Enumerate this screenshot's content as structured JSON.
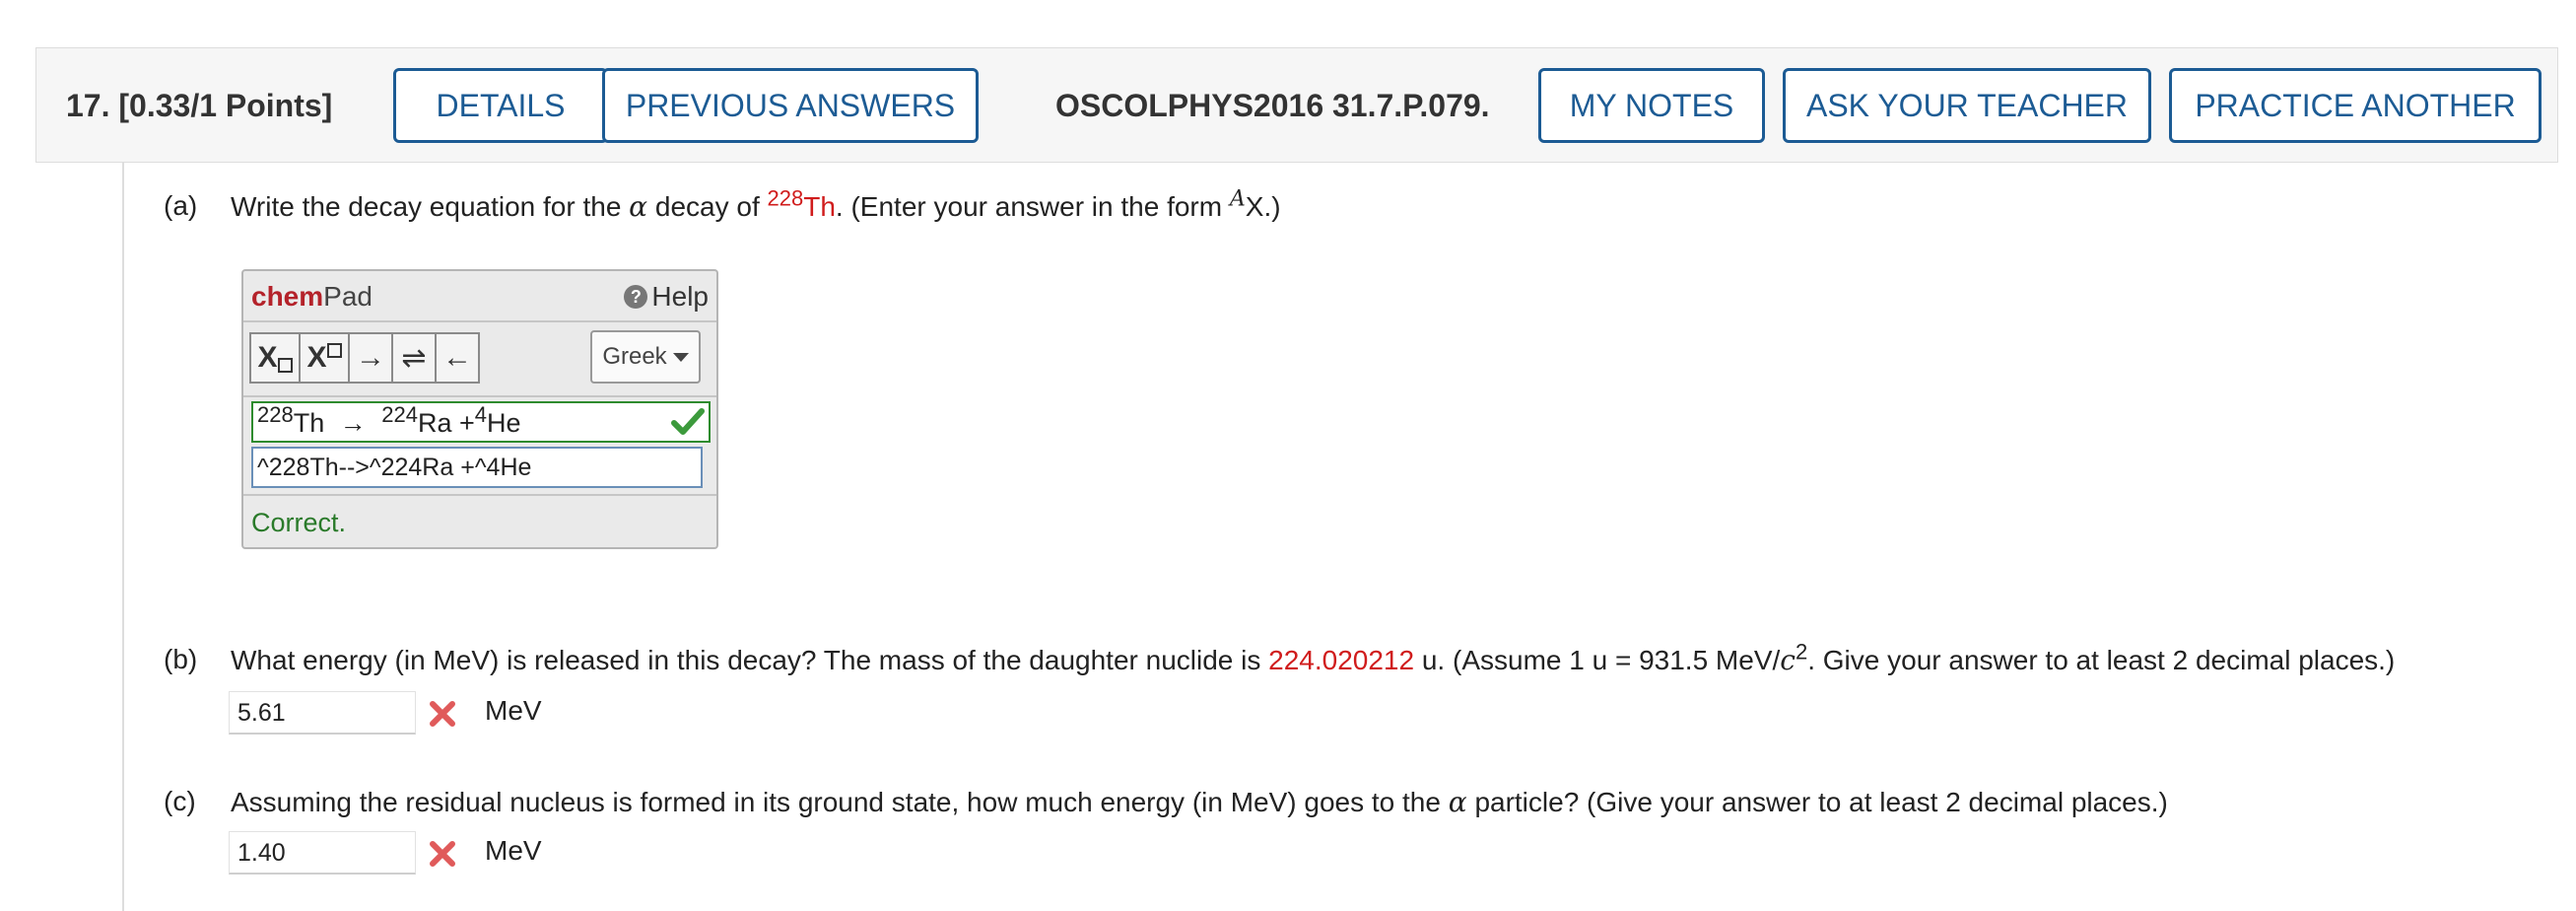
{
  "header": {
    "question_number": "17.",
    "points": "[0.33/1 Points]",
    "details_label": "DETAILS",
    "previous_answers_label": "PREVIOUS ANSWERS",
    "question_code": "OSCOLPHYS2016 31.7.P.079.",
    "my_notes_label": "MY NOTES",
    "ask_teacher_label": "ASK YOUR TEACHER",
    "practice_another_label": "PRACTICE ANOTHER"
  },
  "part_a": {
    "label": "(a)",
    "text_1": "Write the decay equation for the",
    "alpha": "α",
    "text_2": "decay of",
    "mass_number": "228",
    "element": "Th",
    "text_3": ". (Enter your answer in the form",
    "form_sup": "A",
    "form_symbol": "X",
    "text_4": ".)",
    "chempad": {
      "title_bold": "chem",
      "title_rest": "Pad",
      "help_label": "Help",
      "help_glyph": "?",
      "btn_subscript": "X",
      "btn_superscript": "X",
      "btn_arrow": "→",
      "btn_equilibrium": "⇌",
      "btn_back_arrow": "←",
      "greek_label": "Greek",
      "render": {
        "sup1": "228",
        "el1": "Th",
        "arrow": "→",
        "sup2": "224",
        "el2": "Ra +",
        "sup3": "4",
        "el3": "He"
      },
      "input_value": "^228Th-->^224Ra +^4He",
      "status": "Correct."
    }
  },
  "part_b": {
    "label": "(b)",
    "text_1": "What energy (in MeV) is released in this decay? The mass of the daughter nuclide is",
    "mass": "224.020212",
    "text_2": "u. (Assume 1 u = 931.5 MeV/",
    "c": "c",
    "c_sup": "2",
    "text_3": ". Give your answer to at least 2 decimal places.)",
    "answer": "5.61",
    "unit": "MeV"
  },
  "part_c": {
    "label": "(c)",
    "text_1": "Assuming the residual nucleus is formed in its ground state, how much energy (in MeV) goes to the",
    "alpha": "α",
    "text_2": "particle? (Give your answer to at least 2 decimal places.)",
    "answer": "1.40",
    "unit": "MeV"
  },
  "colors": {
    "accent": "#1c5b94",
    "highlight_red": "#d01c1c",
    "correct_green": "#2a7a2a",
    "wrong_red": "#e05a5a"
  }
}
